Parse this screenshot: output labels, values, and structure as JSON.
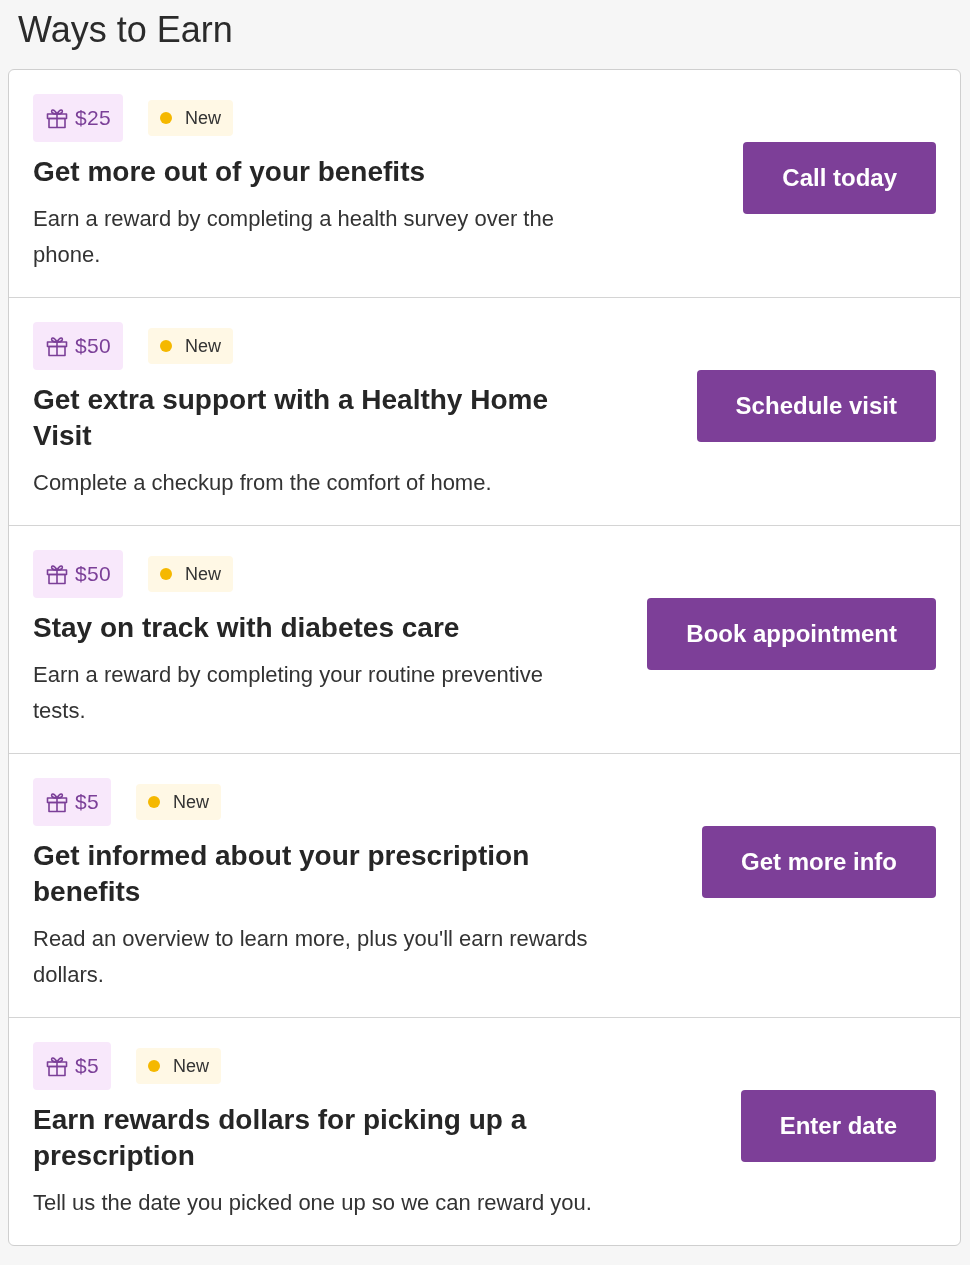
{
  "page": {
    "title": "Ways to Earn"
  },
  "offers": [
    {
      "reward": "$25",
      "badge": "New",
      "title": "Get more out of your benefits",
      "description": "Earn a reward by completing a health survey over the phone.",
      "action": "Call today"
    },
    {
      "reward": "$50",
      "badge": "New",
      "title": "Get extra support with a Healthy Home Visit",
      "description": "Complete a checkup from the comfort of home.",
      "action": "Schedule visit"
    },
    {
      "reward": "$50",
      "badge": "New",
      "title": "Stay on track with diabetes care",
      "description": "Earn a reward by completing your routine preventive tests.",
      "action": "Book appointment"
    },
    {
      "reward": "$5",
      "badge": "New",
      "title": "Get informed about your prescription benefits",
      "description": "Read an overview to learn more, plus you'll earn rewards dollars.",
      "action": "Get more info"
    },
    {
      "reward": "$5",
      "badge": "New",
      "title": "Earn rewards dollars for picking up a prescription",
      "description": "Tell us the date you picked one up so we can reward you.",
      "action": "Enter date"
    }
  ]
}
